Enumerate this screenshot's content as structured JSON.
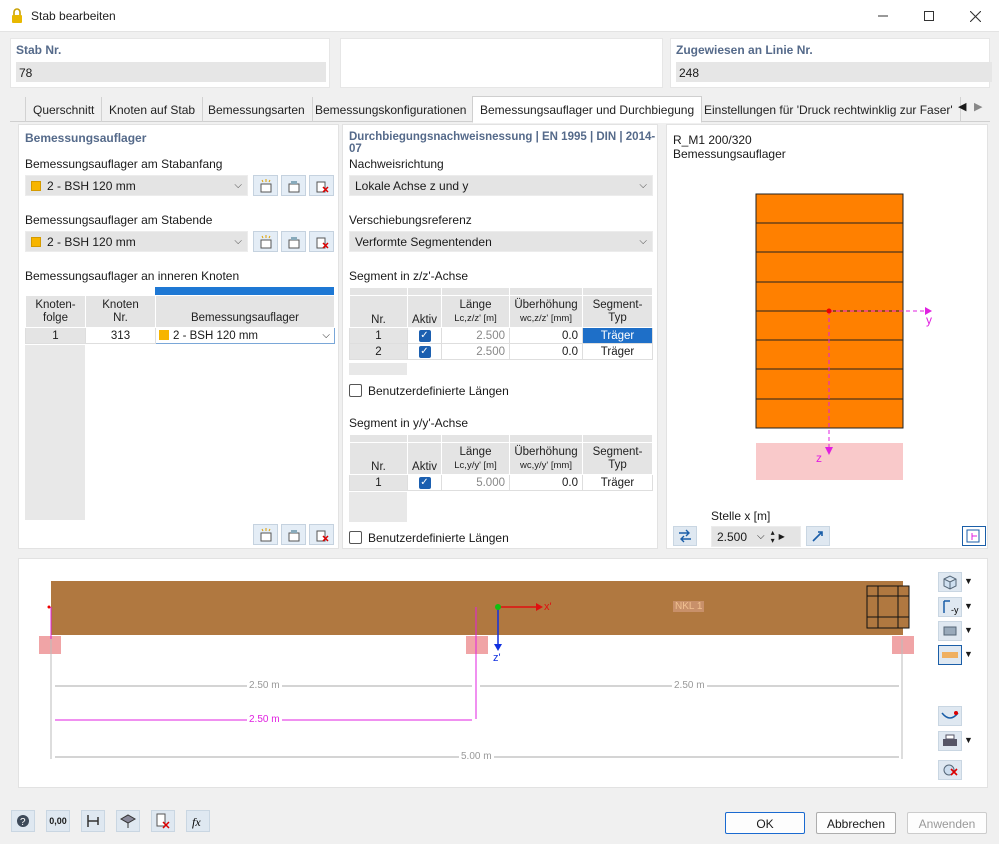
{
  "window": {
    "title": "Stab bearbeiten",
    "min_icon": "minimize-icon",
    "max_icon": "maximize-icon",
    "close_icon": "close-icon"
  },
  "top": {
    "stab_label": "Stab Nr.",
    "stab_value": "78",
    "linie_label": "Zugewiesen an Linie Nr.",
    "linie_value": "248"
  },
  "tabs": [
    "Querschnitt",
    "Knoten auf Stab",
    "Bemessungsarten",
    "Bemessungskonfigurationen",
    "Bemessungsauflager und Durchbiegung",
    "Einstellungen für 'Druck rechtwinklig zur Faser'"
  ],
  "left": {
    "title": "Bemessungsauflager",
    "start_label": "Bemessungsauflager am Stabanfang",
    "start_value": "2 - BSH 120 mm",
    "end_label": "Bemessungsauflager am Stabende",
    "end_value": "2 - BSH 120 mm",
    "inner_label": "Bemessungsauflager an inneren Knoten",
    "cols": {
      "c1a": "Knoten-",
      "c1b": "folge",
      "c2a": "Knoten",
      "c2b": "Nr.",
      "c3": "Bemessungsauflager"
    },
    "row": {
      "folge": "1",
      "knoten": "313",
      "auflager": "2 - BSH 120 mm"
    }
  },
  "mid": {
    "title": "Durchbiegungsnachweisnessung | EN 1995 | DIN | 2014-07",
    "richtung_label": "Nachweisrichtung",
    "richtung_value": "Lokale Achse z und y",
    "ref_label": "Verschiebungsreferenz",
    "ref_value": "Verformte Segmentenden",
    "seg_z_label": "Segment in z/z'-Achse",
    "seg_y_label": "Segment in y/y'-Achse",
    "cols": {
      "nr": "Nr.",
      "aktiv": "Aktiv",
      "laenge": "Länge",
      "ueber": "Überhöhung",
      "typ_a": "Segment-",
      "typ_b": "Typ"
    },
    "z_units": {
      "l": "Lc,z/z' [m]",
      "w": "wc,z/z' [mm]"
    },
    "y_units": {
      "l": "Lc,y/y' [m]",
      "w": "wc,y/y' [mm]"
    },
    "z_rows": [
      {
        "nr": "1",
        "laenge": "2.500",
        "ueber": "0.0",
        "typ": "Träger"
      },
      {
        "nr": "2",
        "laenge": "2.500",
        "ueber": "0.0",
        "typ": "Träger"
      }
    ],
    "y_rows": [
      {
        "nr": "1",
        "laenge": "5.000",
        "ueber": "0.0",
        "typ": "Träger"
      }
    ],
    "user_len": "Benutzerdefinierte Längen"
  },
  "right": {
    "line1": "R_M1 200/320",
    "line2": "Bemessungsauflager",
    "axis_y": "y",
    "axis_z": "z",
    "stelle_label": "Stelle x [m]",
    "stelle_value": "2.500"
  },
  "view": {
    "axis_x": "x'",
    "axis_z": "z'",
    "nkl": "NKL 1",
    "dim_left": "2.50 m",
    "dim_right": "2.50 m",
    "dim_pink": "2.50 m",
    "dim_total": "5.00 m"
  },
  "buttons": {
    "ok": "OK",
    "cancel": "Abbrechen",
    "apply": "Anwenden"
  },
  "bottom_icons": [
    "help-icon",
    "units-icon",
    "members-icon",
    "view-icon",
    "delete-icon",
    "function-icon"
  ],
  "bottom_units": "0,00"
}
